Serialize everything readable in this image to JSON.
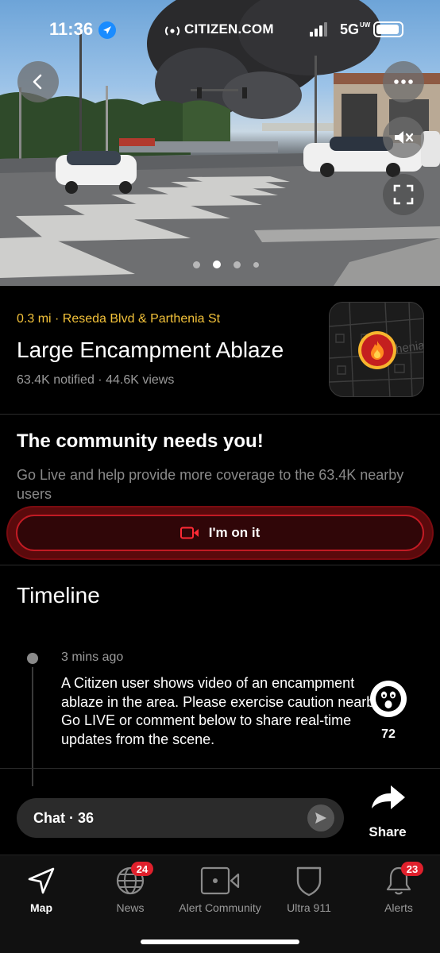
{
  "status_bar": {
    "time": "11:36",
    "carrier": "CITIZEN.COM",
    "network": "5G",
    "network_suffix": "UW"
  },
  "hero": {
    "carousel_count": 4,
    "carousel_active_index": 1
  },
  "incident": {
    "location": "0.3 mi · Reseda Blvd & Parthenia St",
    "title": "Large Encampment Ablaze",
    "stats": "63.4K notified · 44.6K views",
    "map_street_label": "henia"
  },
  "community": {
    "heading": "The community needs you!",
    "body": "Go Live and help provide more coverage to the 63.4K nearby users",
    "button_label": "I'm on it"
  },
  "timeline": {
    "heading": "Timeline",
    "entries": [
      {
        "time": "3 mins ago",
        "text": "A Citizen user shows video of an encampment ablaze in the area. Please exercise caution nearby. Go LIVE or comment below to share real-time updates from the scene."
      }
    ]
  },
  "reaction": {
    "count": "72"
  },
  "chat": {
    "label": "Chat · 36"
  },
  "share": {
    "label": "Share"
  },
  "tabbar": {
    "tabs": [
      {
        "label": "Map",
        "icon": "navigation-arrow-icon",
        "active": true
      },
      {
        "label": "News",
        "icon": "globe-icon",
        "badge": "24"
      },
      {
        "label": "Alert Community",
        "icon": "camera-video-icon"
      },
      {
        "label": "Ultra 911",
        "icon": "shield-icon"
      },
      {
        "label": "Alerts",
        "icon": "bell-icon",
        "badge": "23"
      }
    ]
  },
  "colors": {
    "accent_yellow": "#f3c23a",
    "accent_red": "#c21b24",
    "badge_red": "#e0202c",
    "background": "#000000"
  }
}
